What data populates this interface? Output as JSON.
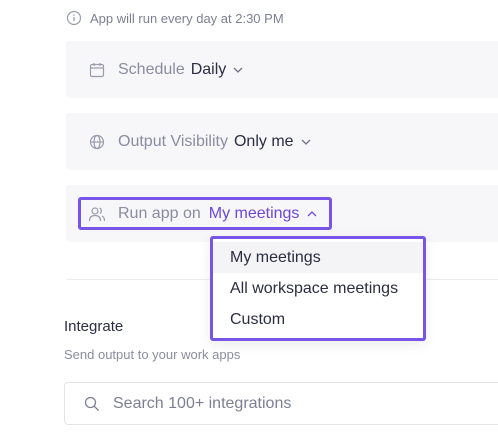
{
  "info": {
    "text": "App will run every day at 2:30 PM"
  },
  "schedule": {
    "label": "Schedule",
    "value": "Daily"
  },
  "visibility": {
    "label": "Output Visibility",
    "value": "Only me"
  },
  "run_on": {
    "label": "Run app on",
    "value": "My meetings",
    "options": [
      "My meetings",
      "All workspace meetings",
      "Custom"
    ]
  },
  "integrate": {
    "title": "Integrate",
    "subtitle": "Send output to your work apps",
    "search_placeholder": "Search 100+ integrations"
  },
  "colors": {
    "accent": "#7755e8",
    "accent_text": "#6c47d9",
    "card_bg": "#f7f7f9",
    "muted": "#8a8ca0"
  }
}
